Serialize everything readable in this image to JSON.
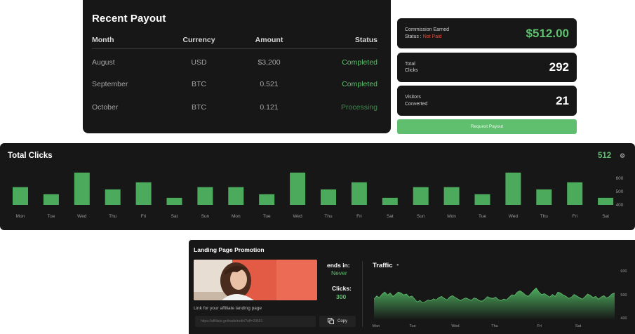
{
  "payout": {
    "title": "Recent Payout",
    "headers": [
      "Month",
      "Currency",
      "Amount",
      "Status"
    ],
    "rows": [
      {
        "month": "August",
        "currency": "USD",
        "amount": "$3,200",
        "status": "Completed"
      },
      {
        "month": "September",
        "currency": "BTC",
        "amount": "0.521",
        "status": "Completed"
      },
      {
        "month": "October",
        "currency": "BTC",
        "amount": "0.121",
        "status": "Processing"
      }
    ]
  },
  "stats": {
    "commission_label": "Commission Earned",
    "status_label": "Status : ",
    "status_value": "Not Paid",
    "commission_value": "$512.00",
    "clicks_label_1": "Total",
    "clicks_label_2": "Clicks",
    "clicks_value": "292",
    "visitors_label_1": "Visitors",
    "visitors_label_2": "Converted",
    "visitors_value": "21",
    "request_button": "Request Payout"
  },
  "total_clicks": {
    "title": "Total Clicks",
    "total": "512",
    "gear_icon": "gear-icon"
  },
  "landing": {
    "title": "Landing Page Promotion",
    "ends_label": "ends in:",
    "ends_value": "Never",
    "clicks_label": "Clicks:",
    "clicks_value": "300",
    "link_label": "Link for your affiliate landing page",
    "link_value": "https://affiliate.gn/trade/redir/?aff=29591",
    "copy_label": "Copy",
    "traffic_title": "Traffic",
    "traffic_icon": "dot-icon"
  },
  "colors": {
    "background": "#171717",
    "accent_green": "#5fbf6f",
    "bar_green": "#4caa5c",
    "warning_red": "#d9503d"
  },
  "chart_data": [
    {
      "type": "bar",
      "title": "Total Clicks",
      "categories": [
        "Mon",
        "Tue",
        "Wed",
        "Thu",
        "Fri",
        "Sat",
        "Sun",
        "Mon",
        "Tue",
        "Wed",
        "Thu",
        "Fri",
        "Sat",
        "Sun",
        "Mon",
        "Tue",
        "Wed",
        "Thu",
        "Fri",
        "Sat"
      ],
      "values": [
        0.55,
        0.33,
        1.0,
        0.48,
        0.7,
        0.22,
        0.55,
        0.55,
        0.33,
        1.0,
        0.48,
        0.7,
        0.22,
        0.55,
        0.55,
        0.33,
        1.0,
        0.48,
        0.7,
        0.22
      ],
      "y_tick_labels": [
        "600",
        "500",
        "400"
      ],
      "grid": false
    },
    {
      "type": "area",
      "title": "Traffic",
      "x_tick_labels": [
        "Mon",
        "Tue",
        "Wed",
        "Thu",
        "Fri",
        "Sat"
      ],
      "y_tick_labels": [
        "600",
        "500",
        "400"
      ],
      "ylim": [
        380,
        640
      ],
      "values": [
        485,
        500,
        492,
        510,
        520,
        505,
        515,
        498,
        508,
        520,
        515,
        505,
        510,
        495,
        500,
        485,
        470,
        478,
        465,
        472,
        480,
        476,
        486,
        480,
        492,
        498,
        488,
        480,
        495,
        502,
        493,
        485,
        477,
        485,
        490,
        484,
        478,
        490,
        486,
        476,
        474,
        484,
        497,
        490,
        488,
        494,
        482,
        477,
        485,
        480,
        494,
        506,
        502,
        520,
        526,
        517,
        505,
        498,
        512,
        528,
        540,
        520,
        507,
        512,
        503,
        495,
        508,
        498,
        520,
        515,
        505,
        498,
        488,
        494,
        508,
        500,
        492,
        484,
        496,
        510,
        503,
        492,
        498,
        484,
        495,
        502,
        490,
        497,
        510,
        515
      ]
    }
  ]
}
